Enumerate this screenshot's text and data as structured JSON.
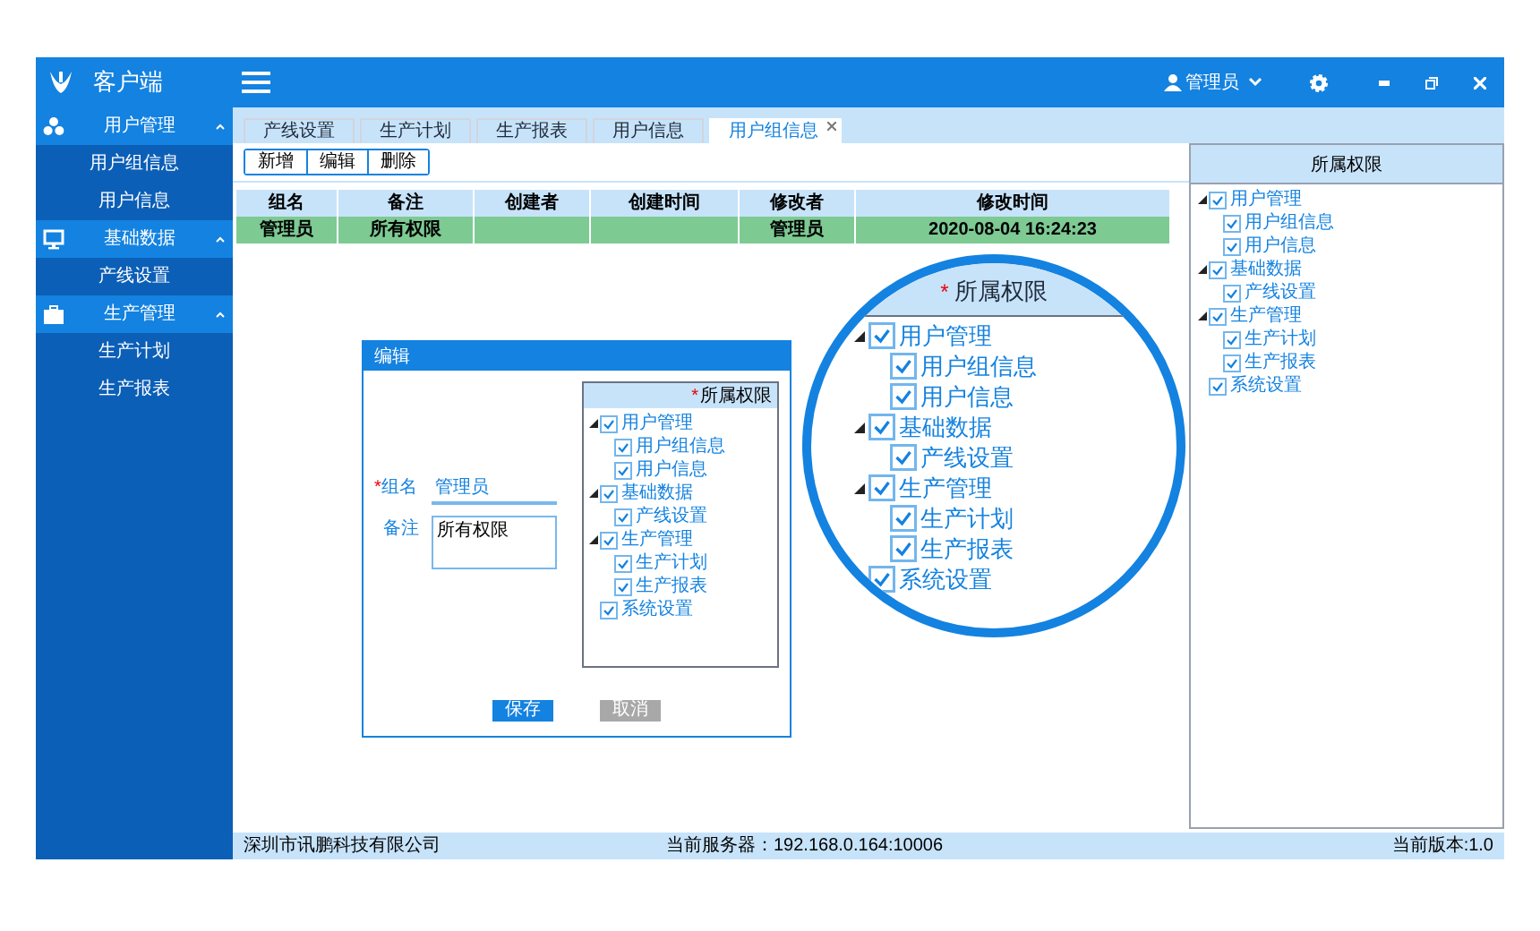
{
  "header": {
    "app_title": "客户端",
    "user": "管理员"
  },
  "sidebar": [
    {
      "label": "用户管理",
      "expanded": true,
      "children": [
        {
          "label": "用户组信息"
        },
        {
          "label": "用户信息"
        }
      ]
    },
    {
      "label": "基础数据",
      "expanded": true,
      "children": [
        {
          "label": "产线设置"
        }
      ]
    },
    {
      "label": "生产管理",
      "expanded": true,
      "children": [
        {
          "label": "生产计划"
        },
        {
          "label": "生产报表"
        }
      ]
    }
  ],
  "tabs": [
    {
      "label": "产线设置",
      "selected": false
    },
    {
      "label": "生产计划",
      "selected": false
    },
    {
      "label": "生产报表",
      "selected": false
    },
    {
      "label": "用户信息",
      "selected": false
    },
    {
      "label": "用户组信息",
      "selected": true,
      "closable": true
    }
  ],
  "toolbar": [
    "新增",
    "编辑",
    "删除"
  ],
  "table": {
    "columns": [
      "组名",
      "备注",
      "创建者",
      "创建时间",
      "修改者",
      "修改时间"
    ],
    "rows": [
      {
        "cells": [
          "管理员",
          "所有权限",
          "",
          "",
          "管理员",
          "2020-08-04 16:24:23"
        ],
        "selected": true
      }
    ]
  },
  "dialog": {
    "title": "编辑",
    "fields": [
      {
        "label": "组名",
        "required_mark": "*",
        "value": "管理员",
        "kind": "line"
      },
      {
        "label": "备注",
        "value": "所有权限",
        "kind": "area"
      }
    ],
    "tree_header": "所属权限",
    "tree_required_mark": "*",
    "tree": [
      {
        "label": "用户管理",
        "checked": true,
        "expanded": true,
        "children": [
          {
            "label": "用户组信息",
            "checked": true
          },
          {
            "label": "用户信息",
            "checked": true
          }
        ]
      },
      {
        "label": "基础数据",
        "checked": true,
        "expanded": true,
        "children": [
          {
            "label": "产线设置",
            "checked": true
          }
        ]
      },
      {
        "label": "生产管理",
        "checked": true,
        "expanded": true,
        "children": [
          {
            "label": "生产计划",
            "checked": true
          },
          {
            "label": "生产报表",
            "checked": true
          }
        ]
      },
      {
        "label": "系统设置",
        "checked": true
      }
    ],
    "buttons": [
      {
        "label": "保存",
        "disabled": false
      },
      {
        "label": "取消",
        "disabled": true
      }
    ]
  },
  "magnifier": {
    "header": "所属权限",
    "required_mark": "*",
    "tree": [
      {
        "label": "用户管理",
        "checked": true,
        "expanded": true,
        "children": [
          {
            "label": "用户组信息",
            "checked": true
          },
          {
            "label": "用户信息",
            "checked": true
          }
        ]
      },
      {
        "label": "基础数据",
        "checked": true,
        "expanded": true,
        "children": [
          {
            "label": "产线设置",
            "checked": true
          }
        ]
      },
      {
        "label": "生产管理",
        "checked": true,
        "expanded": true,
        "children": [
          {
            "label": "生产计划",
            "checked": true
          },
          {
            "label": "生产报表",
            "checked": true
          }
        ]
      },
      {
        "label": "系统设置",
        "checked": true
      }
    ]
  },
  "side_panel": {
    "header": "所属权限",
    "tree": [
      {
        "label": "用户管理",
        "checked": true,
        "expanded": true,
        "children": [
          {
            "label": "用户组信息",
            "checked": true
          },
          {
            "label": "用户信息",
            "checked": true
          }
        ]
      },
      {
        "label": "基础数据",
        "checked": true,
        "expanded": true,
        "children": [
          {
            "label": "产线设置",
            "checked": true
          }
        ]
      },
      {
        "label": "生产管理",
        "checked": true,
        "expanded": true,
        "children": [
          {
            "label": "生产计划",
            "checked": true
          },
          {
            "label": "生产报表",
            "checked": true
          }
        ]
      },
      {
        "label": "系统设置",
        "checked": true
      }
    ]
  },
  "status_bar": {
    "company": "深圳市讯鹏科技有限公司",
    "server": "当前服务器：192.168.0.164:10006",
    "version": "当前版本:1.0"
  }
}
